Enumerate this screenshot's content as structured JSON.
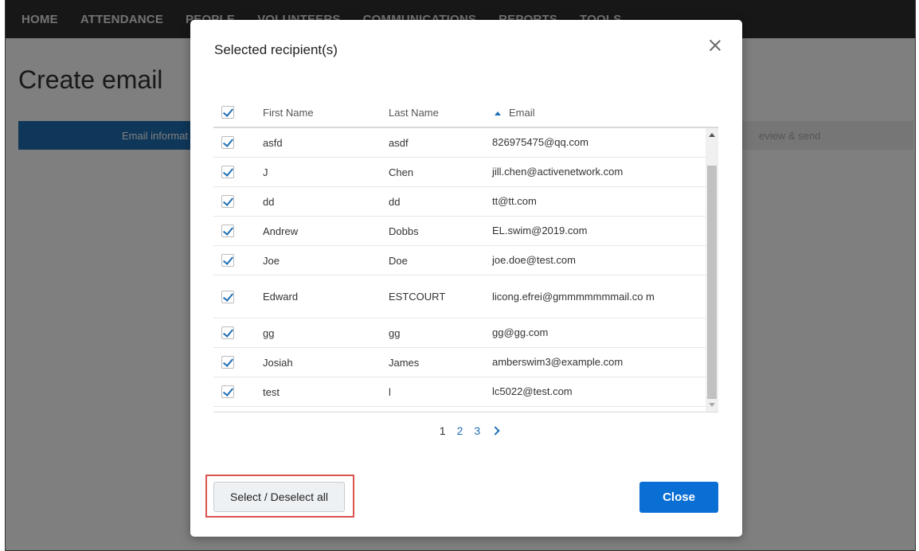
{
  "nav": {
    "items": [
      "HOME",
      "ATTENDANCE",
      "PEOPLE",
      "VOLUNTEERS",
      "COMMUNICATIONS",
      "REPORTS",
      "TOOLS"
    ]
  },
  "page": {
    "title": "Create email",
    "step_active": "Email informat",
    "step_last": "eview & send"
  },
  "modal": {
    "title": "Selected recipient(s)",
    "columns": {
      "first_name": "First Name",
      "last_name": "Last Name",
      "email": "Email"
    },
    "rows": [
      {
        "first": "asfd",
        "last": "asdf",
        "email": "826975475@qq.com",
        "checked": true
      },
      {
        "first": "J",
        "last": "Chen",
        "email": "jill.chen@activenetwork.com",
        "checked": true
      },
      {
        "first": "dd",
        "last": "dd",
        "email": "tt@tt.com",
        "checked": true
      },
      {
        "first": "Andrew",
        "last": "Dobbs",
        "email": "EL.swim@2019.com",
        "checked": true
      },
      {
        "first": "Joe",
        "last": "Doe",
        "email": "joe.doe@test.com",
        "checked": true
      },
      {
        "first": "Edward",
        "last": "ESTCOURT",
        "email": "licong.efrei@gmmmmmmmail.co m",
        "checked": true
      },
      {
        "first": "gg",
        "last": "gg",
        "email": "gg@gg.com",
        "checked": true
      },
      {
        "first": "Josiah",
        "last": "James",
        "email": "amberswim3@example.com",
        "checked": true
      },
      {
        "first": "test",
        "last": "l",
        "email": "lc5022@test.com",
        "checked": true
      }
    ],
    "pagination": {
      "pages": [
        "1",
        "2",
        "3"
      ],
      "current": "1"
    },
    "select_all_label": "Select / Deselect all",
    "close_label": "Close"
  },
  "colors": {
    "accent": "#1f6fb5",
    "primary_button": "#0a6fd4",
    "highlight": "#d9534f"
  }
}
